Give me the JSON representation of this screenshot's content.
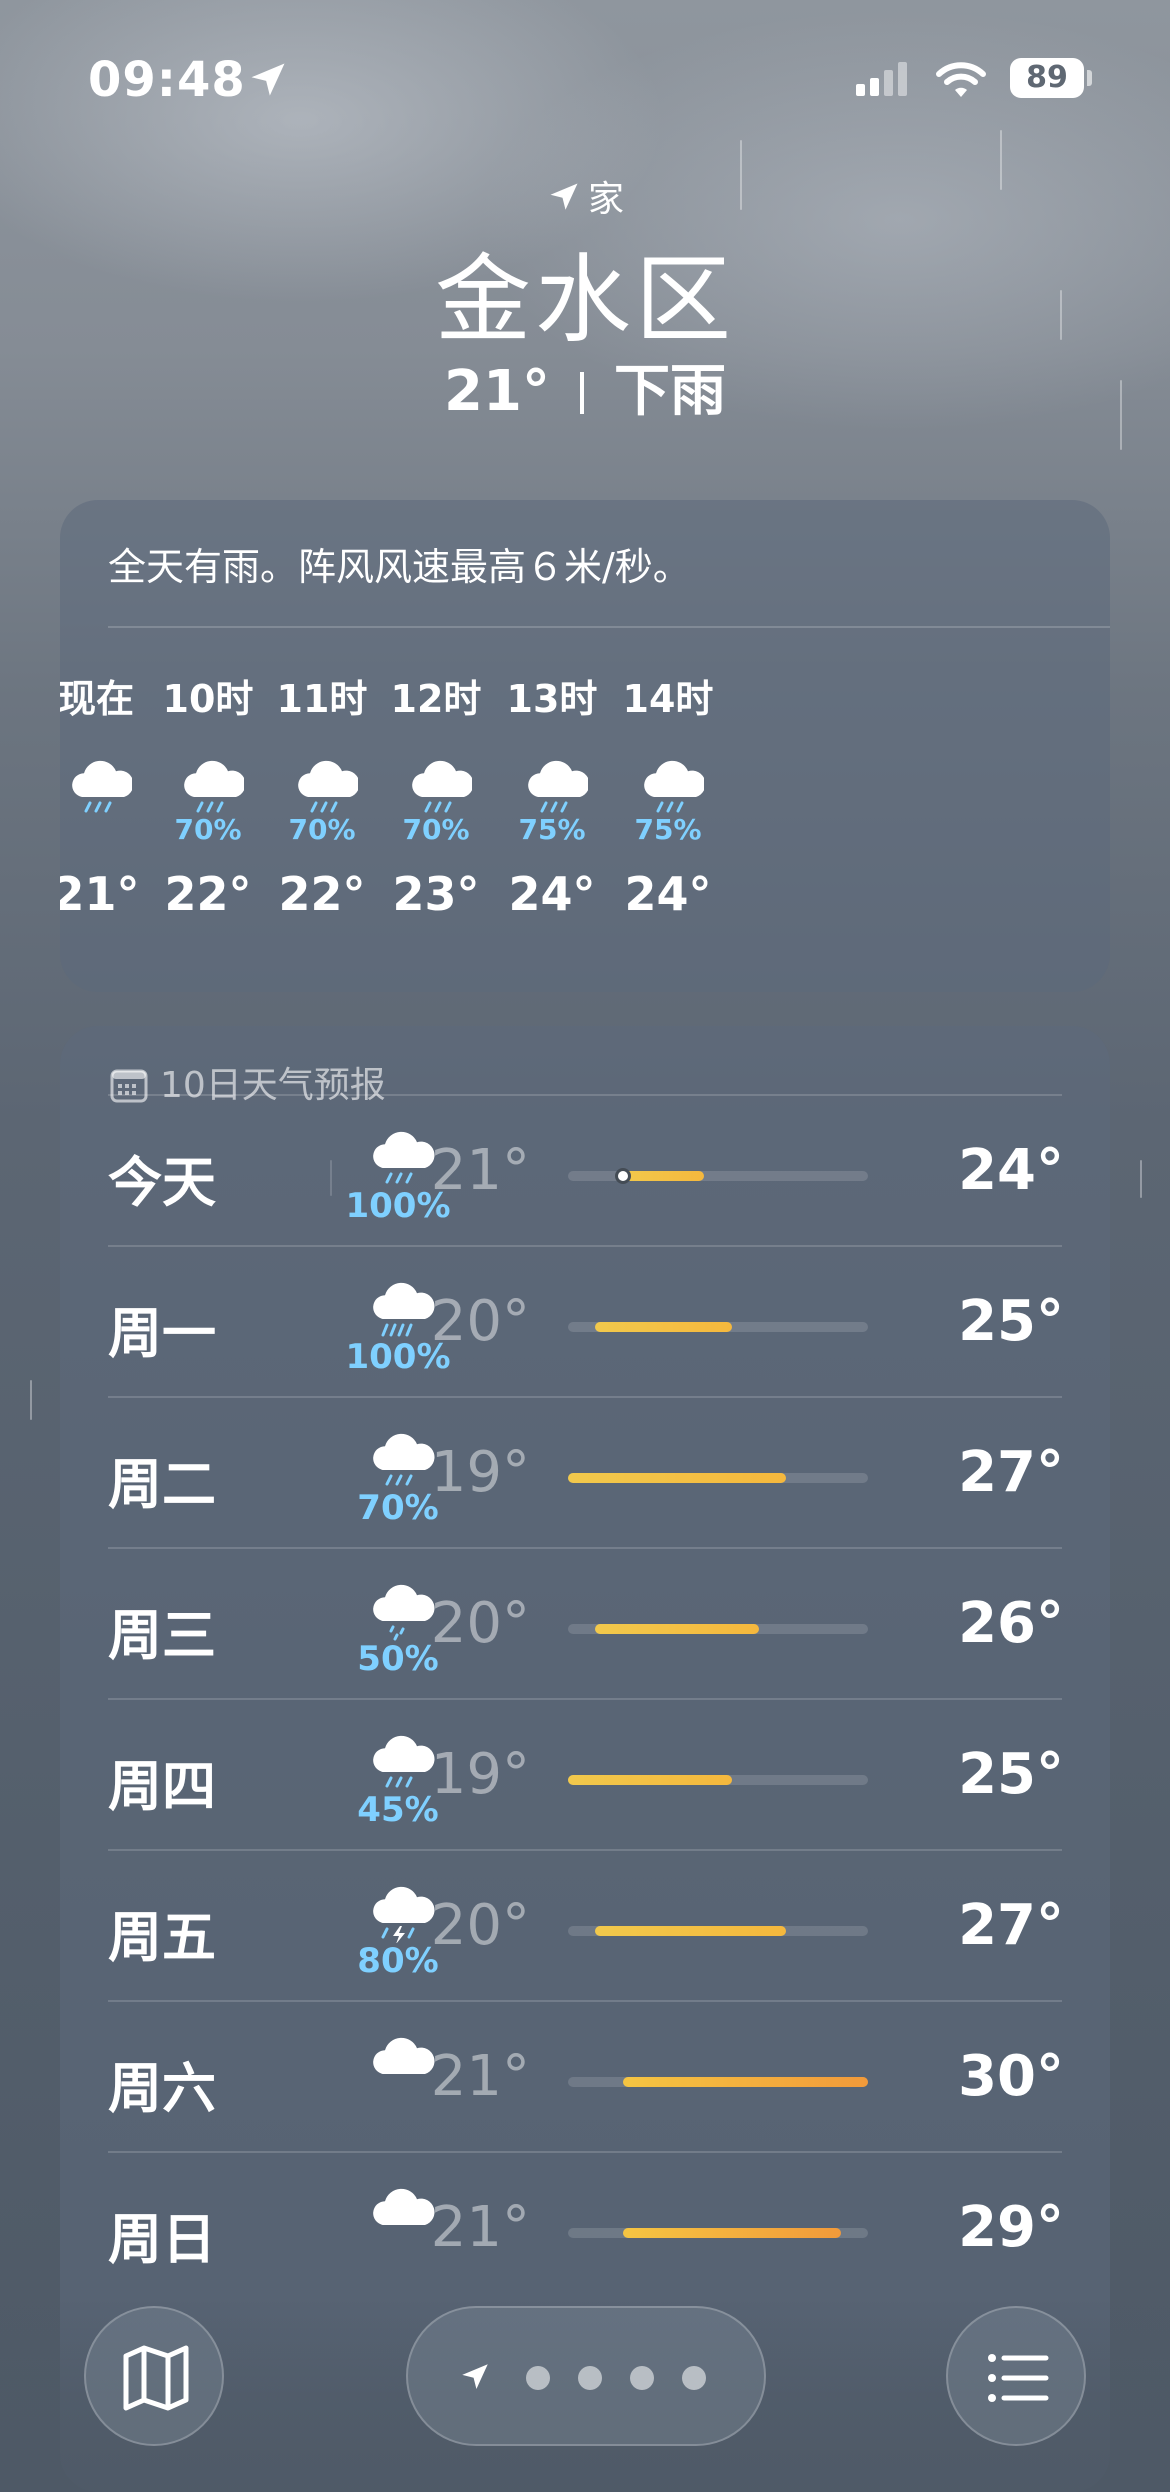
{
  "status_bar": {
    "time": "09:48",
    "battery": "89",
    "location_icon": "location-arrow-icon"
  },
  "header": {
    "place_label": "家",
    "city": "金水区",
    "temperature": "21°",
    "condition": "下雨"
  },
  "hourly": {
    "summary": "全天有雨。阵风风速最高６米/秒。",
    "items": [
      {
        "label": "现在",
        "icon": "rain-cloud-icon",
        "pct": "",
        "temp": "21°"
      },
      {
        "label": "10时",
        "icon": "rain-cloud-icon",
        "pct": "70%",
        "temp": "22°"
      },
      {
        "label": "11时",
        "icon": "rain-cloud-icon",
        "pct": "70%",
        "temp": "22°"
      },
      {
        "label": "12时",
        "icon": "rain-cloud-icon",
        "pct": "70%",
        "temp": "23°"
      },
      {
        "label": "13时",
        "icon": "rain-cloud-icon",
        "pct": "75%",
        "temp": "24°"
      },
      {
        "label": "14时",
        "icon": "rain-cloud-icon",
        "pct": "75%",
        "temp": "24°"
      }
    ]
  },
  "daily": {
    "title": "10日天气预报",
    "range_min": 19,
    "range_max": 30,
    "rows": [
      {
        "day": "今天",
        "icon": "rain-cloud-icon",
        "pct": "100%",
        "low": "21°",
        "high": "24°",
        "lo": 21,
        "hi": 24,
        "current": 21
      },
      {
        "day": "周一",
        "icon": "heavy-rain-cloud-icon",
        "pct": "100%",
        "low": "20°",
        "high": "25°",
        "lo": 20,
        "hi": 25
      },
      {
        "day": "周二",
        "icon": "rain-cloud-icon",
        "pct": "70%",
        "low": "19°",
        "high": "27°",
        "lo": 19,
        "hi": 27
      },
      {
        "day": "周三",
        "icon": "drizzle-cloud-icon",
        "pct": "50%",
        "low": "20°",
        "high": "26°",
        "lo": 20,
        "hi": 26
      },
      {
        "day": "周四",
        "icon": "rain-cloud-icon",
        "pct": "45%",
        "low": "19°",
        "high": "25°",
        "lo": 19,
        "hi": 25
      },
      {
        "day": "周五",
        "icon": "thunderstorm-cloud-icon",
        "pct": "80%",
        "low": "20°",
        "high": "27°",
        "lo": 20,
        "hi": 27
      },
      {
        "day": "周六",
        "icon": "cloud-icon",
        "pct": "",
        "low": "21°",
        "high": "30°",
        "lo": 21,
        "hi": 30
      },
      {
        "day": "周日",
        "icon": "cloud-icon",
        "pct": "",
        "low": "21°",
        "high": "29°",
        "lo": 21,
        "hi": 29
      }
    ]
  },
  "toolbar": {
    "map_icon": "map-icon",
    "location_icon": "location-arrow-icon",
    "list_icon": "list-icon",
    "page_dots": 4
  },
  "colors": {
    "pct": "#7fd0ff",
    "bar_cool": "#f5c542",
    "bar_warm": "#f29a3a"
  }
}
